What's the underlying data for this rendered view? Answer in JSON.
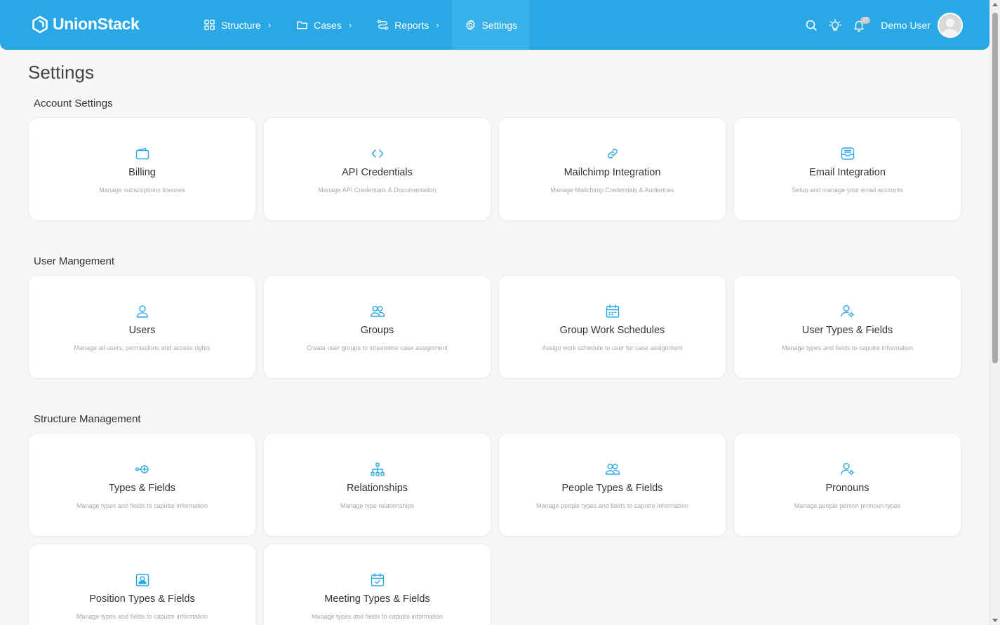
{
  "brand": {
    "name": "UnionStack",
    "color": "#2aa8e6"
  },
  "nav": [
    {
      "label": "Structure",
      "icon": "grid-icon",
      "has_chevron": true
    },
    {
      "label": "Cases",
      "icon": "folder-icon",
      "has_chevron": true
    },
    {
      "label": "Reports",
      "icon": "route-icon",
      "has_chevron": true
    },
    {
      "label": "Settings",
      "icon": "gear-icon",
      "has_chevron": false,
      "active": true
    }
  ],
  "topbar": {
    "notifications_count": "27",
    "user_name": "Demo User"
  },
  "page": {
    "title": "Settings"
  },
  "sections": [
    {
      "title": "Account Settings",
      "cards": [
        {
          "title": "Billing",
          "desc": "Manage subscriptions licenses",
          "icon": "wallet-icon"
        },
        {
          "title": "API Credentials",
          "desc": "Manage API Credentials & Documentation",
          "icon": "code-icon"
        },
        {
          "title": "Mailchimp Integration",
          "desc": "Manage Mailchimp Credentials & Audiences",
          "icon": "link-icon"
        },
        {
          "title": "Email Integration",
          "desc": "Setup and manage your email accounts",
          "icon": "inbox-icon"
        }
      ]
    },
    {
      "title": "User Mangement",
      "cards": [
        {
          "title": "Users",
          "desc": "Manage all users, permissions and access rights",
          "icon": "user-icon"
        },
        {
          "title": "Groups",
          "desc": "Create user groups to streamline case assignment",
          "icon": "users-icon"
        },
        {
          "title": "Group Work Schedules",
          "desc": "Assign work schedule to user for case assignment",
          "icon": "calendar-icon"
        },
        {
          "title": "User Types & Fields",
          "desc": "Manage types and fields to caputre information",
          "icon": "user-settings-icon"
        }
      ]
    },
    {
      "title": "Structure Management",
      "cards": [
        {
          "title": "Types & Fields",
          "desc": "Manage types and fields to caputre information",
          "icon": "add-node-icon"
        },
        {
          "title": "Relationships",
          "desc": "Manage type relationships",
          "icon": "hierarchy-icon"
        },
        {
          "title": "People Types & Fields",
          "desc": "Manage people types and fields to caputre information",
          "icon": "users-icon"
        },
        {
          "title": "Pronouns",
          "desc": "Manage people person pronoun types",
          "icon": "user-settings-icon"
        },
        {
          "title": "Position Types & Fields",
          "desc": "Manage types and fields to caputre information",
          "icon": "id-badge-icon"
        },
        {
          "title": "Meeting Types & Fields",
          "desc": "Manage types and fields to caputre information",
          "icon": "calendar-check-icon"
        }
      ]
    }
  ]
}
